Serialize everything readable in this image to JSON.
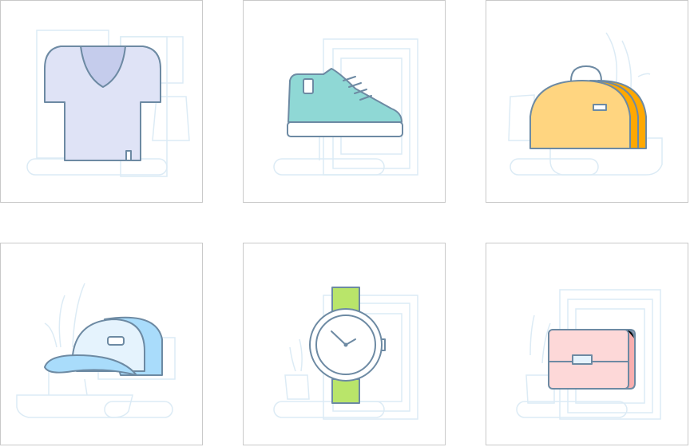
{
  "products": [
    {
      "id": "tshirt",
      "icon": "t-shirt-icon",
      "fill": "#dfe3f6",
      "accent": "#c5ccec"
    },
    {
      "id": "sneaker",
      "icon": "sneaker-icon",
      "fill": "#8fd8d5",
      "accent": "#ffffff"
    },
    {
      "id": "duffel-bag",
      "icon": "duffel-bag-icon",
      "fill": "#ffd580",
      "accent": "#ffa800"
    },
    {
      "id": "cap",
      "icon": "baseball-cap-icon",
      "fill": "#e5f3fd",
      "accent": "#a9dcfb"
    },
    {
      "id": "watch",
      "icon": "wristwatch-icon",
      "fill": "#ffffff",
      "accent": "#b9e56a"
    },
    {
      "id": "briefcase",
      "icon": "briefcase-icon",
      "fill": "#fdd8d8",
      "accent": "#f9aeae"
    }
  ],
  "colors": {
    "outline": "#6d8aa3",
    "background_lines": "#dcebf5",
    "card_border": "#c9c9c9"
  }
}
